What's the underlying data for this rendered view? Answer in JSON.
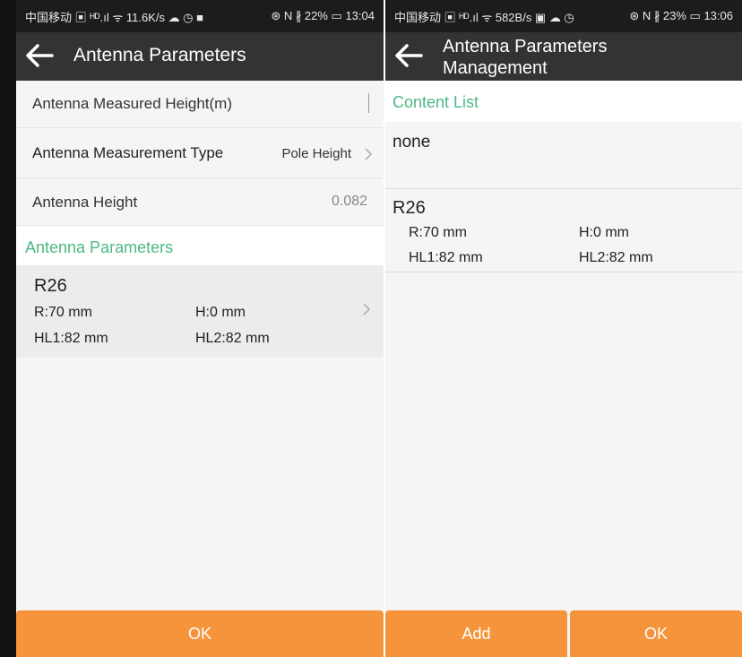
{
  "left_screen": {
    "status": {
      "left": "中国移动 ▣ ᴴᴰ.ıl ᯤ 11.6K/s ☁ ◷ ■",
      "right": "⊛ N ∦ 22% ▭ 13:04"
    },
    "title": "Antenna Parameters",
    "rows": {
      "measured_height_label": "Antenna Measured Height(m)",
      "measurement_type_label": "Antenna Measurement Type",
      "measurement_type_value": "Pole Height",
      "antenna_height_label": "Antenna Height",
      "antenna_height_value": "0.082"
    },
    "section_title": "Antenna Parameters",
    "card": {
      "name": "R26",
      "r": "R:70 mm",
      "h": "H:0 mm",
      "hl1": "HL1:82 mm",
      "hl2": "HL2:82 mm"
    },
    "ok_label": "OK"
  },
  "right_screen": {
    "status": {
      "left": "中国移动 ▣ ᴴᴰ.ıl ᯤ 582B/s ▣ ☁ ◷",
      "right": "⊛ N ∦ 23% ▭ 13:06"
    },
    "title_line1": "Antenna Parameters",
    "title_line2": "Management",
    "section_title": "Content List",
    "none_text": "none",
    "card": {
      "name": "R26",
      "r": "R:70 mm",
      "h": "H:0 mm",
      "hl1": "HL1:82 mm",
      "hl2": "HL2:82 mm"
    },
    "add_label": "Add",
    "ok_label": "OK"
  },
  "colors": {
    "accent": "#f5943b",
    "section_text": "#4db885",
    "toolbar": "#333333",
    "statusbar": "#1c1c1c"
  },
  "icons": [
    "back-arrow-icon",
    "chevron-right-icon"
  ]
}
